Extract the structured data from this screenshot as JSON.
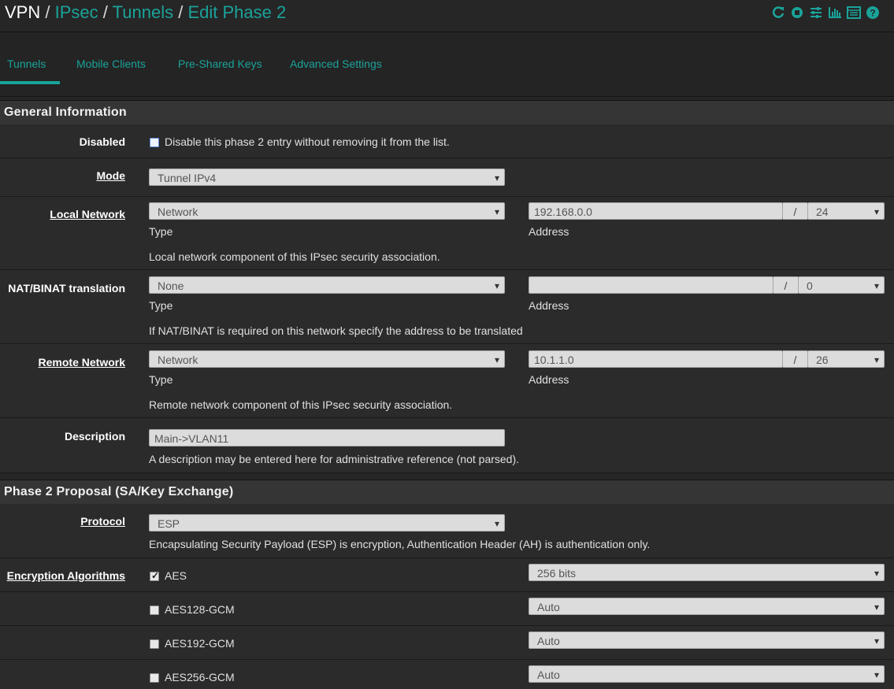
{
  "breadcrumb": {
    "home": "VPN",
    "items": [
      "IPsec",
      "Tunnels",
      "Edit Phase 2"
    ],
    "separator": "/"
  },
  "header_icons": [
    "reload-icon",
    "stop-icon",
    "sliders-icon",
    "chart-icon",
    "table-icon",
    "help-icon"
  ],
  "tabs": [
    {
      "label": "Tunnels",
      "active": true
    },
    {
      "label": "Mobile Clients",
      "active": false
    },
    {
      "label": "Pre-Shared Keys",
      "active": false
    },
    {
      "label": "Advanced Settings",
      "active": false
    }
  ],
  "general": {
    "title": "General Information",
    "disabled": {
      "label": "Disabled",
      "text": "Disable this phase 2 entry without removing it from the list.",
      "checked": false
    },
    "mode": {
      "label": "Mode",
      "value": "Tunnel IPv4"
    },
    "local_network": {
      "label": "Local Network",
      "type": "Network",
      "type_caption": "Type",
      "address": "192.168.0.0",
      "address_caption": "Address",
      "cidr": "24",
      "help": "Local network component of this IPsec security association."
    },
    "nat": {
      "label": "NAT/BINAT translation",
      "type": "None",
      "type_caption": "Type",
      "address": "",
      "address_caption": "Address",
      "cidr": "0",
      "help": "If NAT/BINAT is required on this network specify the address to be translated"
    },
    "remote_network": {
      "label": "Remote Network",
      "type": "Network",
      "type_caption": "Type",
      "address": "10.1.1.0",
      "address_caption": "Address",
      "cidr": "26",
      "help": "Remote network component of this IPsec security association."
    },
    "description": {
      "label": "Description",
      "value": "Main->VLAN11",
      "help": "A description may be entered here for administrative reference (not parsed)."
    }
  },
  "proposal": {
    "title": "Phase 2 Proposal (SA/Key Exchange)",
    "protocol": {
      "label": "Protocol",
      "value": "ESP",
      "help": "Encapsulating Security Payload (ESP) is encryption, Authentication Header (AH) is authentication only."
    },
    "encryption_label": "Encryption Algorithms",
    "algorithms": [
      {
        "name": "AES",
        "checked": true,
        "keylen": "256 bits"
      },
      {
        "name": "AES128-GCM",
        "checked": false,
        "keylen": "Auto"
      },
      {
        "name": "AES192-GCM",
        "checked": false,
        "keylen": "Auto"
      },
      {
        "name": "AES256-GCM",
        "checked": false,
        "keylen": "Auto"
      }
    ]
  },
  "colors": {
    "accent": "#1aa39a",
    "background": "#262626",
    "panel_header": "#353535"
  }
}
